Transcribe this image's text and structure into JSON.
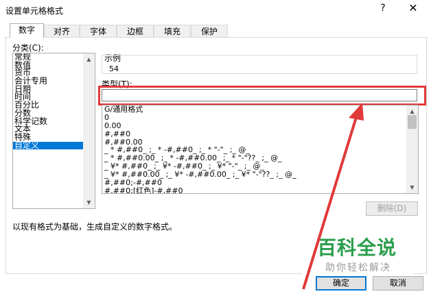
{
  "window": {
    "title": "设置单元格格式",
    "help_label": "?",
    "close_label": "✕"
  },
  "tabs": [
    {
      "label": "数字",
      "active": true
    },
    {
      "label": "对齐",
      "active": false
    },
    {
      "label": "字体",
      "active": false
    },
    {
      "label": "边框",
      "active": false
    },
    {
      "label": "填充",
      "active": false
    },
    {
      "label": "保护",
      "active": false
    }
  ],
  "category": {
    "label": "分类(C):",
    "items": [
      "常规",
      "数值",
      "货币",
      "会计专用",
      "日期",
      "时间",
      "百分比",
      "分数",
      "科学记数",
      "文本",
      "特殊",
      "自定义"
    ],
    "selected": "自定义"
  },
  "sample": {
    "label": "示例",
    "value": "54"
  },
  "type": {
    "label": "类型(T):",
    "value": ""
  },
  "formats": [
    "G/通用格式",
    "0",
    "0.00",
    "#,##0",
    "#,##0.00",
    "_ * #,##0_ ;_ * -#,##0_ ;_ * \"-\"_ ;_ @_",
    "_ * #,##0.00_ ;_ * -#,##0.00_ ;_ * \"-\"??_ ;_ @_",
    "_ ¥* #,##0_ ;_ ¥* -#,##0_ ;_ ¥* \"-\"_ ;_ @_",
    "_ ¥* #,##0.00_ ;_ ¥* -#,##0.00_ ;_ ¥* \"-\"??_ ;_ @_",
    "#,##0;-#,##0",
    "#,##0;[红色]-#,##0"
  ],
  "buttons": {
    "delete": "删除(D)",
    "ok": "确定",
    "cancel": "取消"
  },
  "description": "以现有格式为基础，生成自定义的数字格式。",
  "watermark": {
    "title": "百科全说",
    "subtitle": "助你轻松解决"
  },
  "colors": {
    "highlight": "#e03a3a",
    "selection": "#0078d7",
    "watermark": "#2a9d4b"
  }
}
